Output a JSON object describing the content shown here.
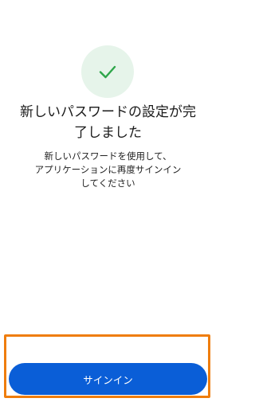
{
  "status": {
    "icon": "checkmark-icon",
    "colors": {
      "circle_background": "#e6f4ea",
      "check": "#2ea64a"
    }
  },
  "title": {
    "line1": "新しいパスワードの設定が完",
    "line2": "了しました"
  },
  "message": {
    "line1": "新しいパスワードを使用して、",
    "line2": "アプリケーションに再度サインイン",
    "line3": "してください"
  },
  "actions": {
    "signin_label": "サインイン",
    "button_color": "#0a5ed7",
    "highlight_color": "#ef7d0d"
  }
}
